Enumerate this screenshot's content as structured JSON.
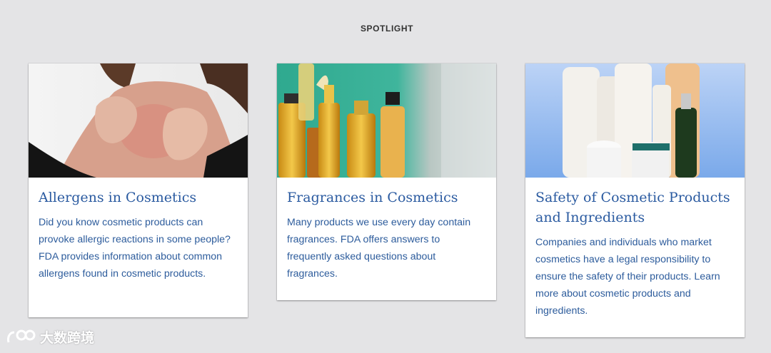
{
  "spotlight": {
    "heading": "SPOTLIGHT",
    "cards": [
      {
        "title": "Allergens in Cosmetics",
        "text": "Did you know cosmetic products can provoke allergic reactions in some people? FDA provides information about common allergens found in cosmetic products.",
        "image": "woman-scratching-neck-photo"
      },
      {
        "title": "Fragrances in Cosmetics",
        "text": "Many products we use every day contain fragrances. FDA offers answers to frequently asked questions about fragrances.",
        "image": "perfume-bottles-photo"
      },
      {
        "title": "Safety of Cosmetic Products and Ingredients",
        "text": "Companies and individuals who market cosmetics have a legal responsibility to ensure the safety of their products. Learn more about cosmetic products and ingredients.",
        "image": "cosmetic-containers-photo"
      }
    ]
  },
  "watermark": {
    "text": "大数跨境"
  },
  "colors": {
    "title": "#2a5aa0",
    "body_text": "#2d5c9c",
    "background": "#e4e4e6"
  }
}
